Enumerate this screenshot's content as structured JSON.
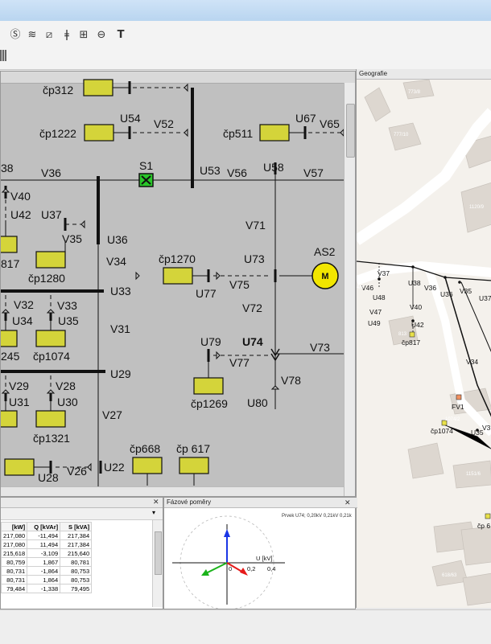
{
  "toolbar": {
    "icons": [
      {
        "name": "circle-s-icon",
        "glyph": "Ⓢ"
      },
      {
        "name": "wave-icon",
        "glyph": "≋"
      },
      {
        "name": "transformer-icon",
        "glyph": "⧄"
      },
      {
        "name": "fuse-icon",
        "glyph": "ǂ"
      },
      {
        "name": "meter-icon",
        "glyph": "⊞"
      },
      {
        "name": "source-icon",
        "glyph": "⊖"
      },
      {
        "name": "text-icon",
        "glyph": "T"
      }
    ]
  },
  "schema": {
    "labels": {
      "cp312": "čp312",
      "cp1222": "čp1222",
      "U54": "U54",
      "V52": "V52",
      "cp511": "čp511",
      "U67": "U67",
      "V65": "V65",
      "n38": "38",
      "V36": "V36",
      "S1": "S1",
      "U53": "U53",
      "V56": "V56",
      "U58": "U58",
      "V57": "V57",
      "V40": "V40",
      "U42": "U42",
      "U37": "U37",
      "V35": "V35",
      "U36": "U36",
      "n817": "817",
      "cp1280": "čp1280",
      "V34": "V34",
      "V71": "V71",
      "AS2": "AS2",
      "M": "M",
      "cp1270": "čp1270",
      "U73": "U73",
      "U77": "U77",
      "V75": "V75",
      "U33": "U33",
      "V32": "V32",
      "V33": "V33",
      "U34": "U34",
      "U35": "U35",
      "V72": "V72",
      "V31": "V31",
      "n245": "245",
      "cp1074": "čp1074",
      "U79": "U79",
      "U74": "U74",
      "V73": "V73",
      "U29": "U29",
      "V77": "V77",
      "V29": "V29",
      "V28": "V28",
      "U31": "U31",
      "U30": "U30",
      "V78": "V78",
      "cp1269": "čp1269",
      "U80": "U80",
      "V27": "V27",
      "cp1321": "čp1321",
      "cp668": "čp668",
      "cp617": "čp 617",
      "U28": "U28",
      "V26": "V26",
      "U22": "U22"
    }
  },
  "geo": {
    "title": "Geografie",
    "parcels": [
      "773/8",
      "777/10",
      "1120/9",
      "813",
      "1074/2",
      "1151/6",
      "618/63",
      "4/6"
    ],
    "labels": {
      "V37": "V37",
      "V46": "V46",
      "U48": "U48",
      "V47": "V47",
      "U49": "U49",
      "U38": "U38",
      "V36": "V36",
      "U36": "U36",
      "V35": "V35",
      "U37": "U37",
      "V40": "V40",
      "U42": "U42",
      "cp817": "čp817",
      "V34": "V34",
      "FV1": "FV1",
      "cp1074": "čp1074",
      "U35": "U35",
      "V3": "V3",
      "cp6": "čp 6"
    }
  },
  "table": {
    "headers": [
      "[kW]",
      "Q [kVAr]",
      "S [kVA]"
    ],
    "rows": [
      [
        "217,080",
        "-11,494",
        "217,384"
      ],
      [
        "217,080",
        "11,494",
        "217,384"
      ],
      [
        "215,618",
        "-3,109",
        "215,640"
      ],
      [
        "80,759",
        "1,867",
        "80,781"
      ],
      [
        "80,731",
        "-1,864",
        "80,753"
      ],
      [
        "80,731",
        "1,864",
        "80,753"
      ],
      [
        "79,484",
        "-1,338",
        "79,495"
      ]
    ]
  },
  "phase": {
    "title": "Fázové poměry",
    "info": "Prvek U74; 0,20kV 0,21kV 0,21k",
    "axis_label": "U [kV]",
    "tick0": "0",
    "tick1": "0,2",
    "tick2": "0,4"
  },
  "colors": {
    "box_fill": "#d4d43a",
    "switch_fill": "#29c629",
    "motor_fill": "#f2e600"
  }
}
